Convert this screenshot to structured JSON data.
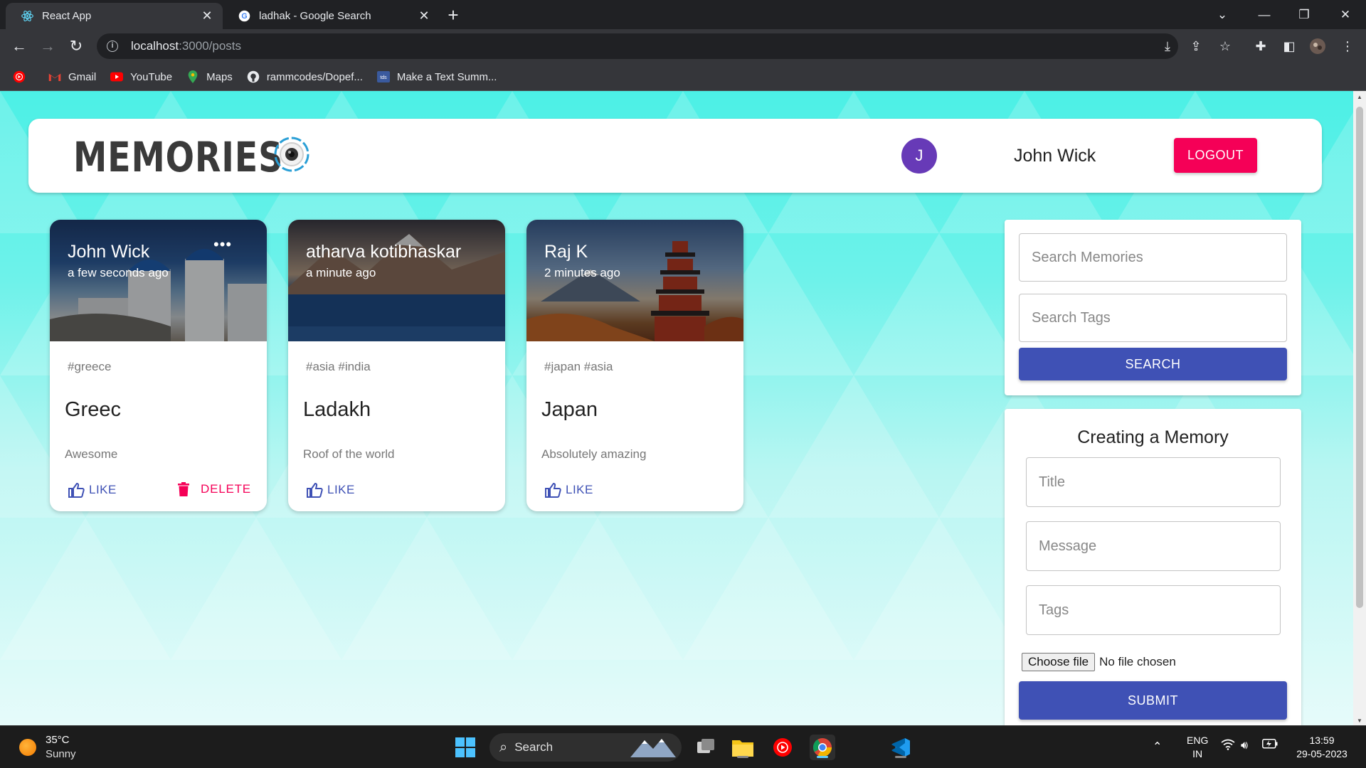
{
  "browser": {
    "tabs": [
      {
        "title": "React App",
        "active": true
      },
      {
        "title": "ladhak - Google Search",
        "active": false
      }
    ],
    "url_host": "localhost",
    "url_path": ":3000/posts",
    "bookmarks": [
      "Gmail",
      "YouTube",
      "Maps",
      "rammcodes/Dopef...",
      "Make a Text Summ..."
    ]
  },
  "header": {
    "brand": "MEMORIES",
    "avatar_initial": "J",
    "user_name": "John Wick",
    "logout_label": "LOGOUT"
  },
  "posts": [
    {
      "author": "John Wick",
      "time": "a few seconds ago",
      "tags": "#greece",
      "title": "Greec",
      "message": "Awesome",
      "like_label": "LIKE",
      "delete_label": "DELETE"
    },
    {
      "author": "atharva kotibhaskar",
      "time": "a minute ago",
      "tags": "#asia #india",
      "title": "Ladakh",
      "message": "Roof of the world",
      "like_label": "LIKE"
    },
    {
      "author": "Raj K",
      "time": "2 minutes ago",
      "tags": "#japan #asia",
      "title": "Japan",
      "message": "Absolutely amazing",
      "like_label": "LIKE"
    }
  ],
  "search": {
    "memories_placeholder": "Search Memories",
    "tags_placeholder": "Search Tags",
    "button_label": "SEARCH"
  },
  "form": {
    "heading": "Creating a Memory",
    "title_placeholder": "Title",
    "message_placeholder": "Message",
    "tags_placeholder": "Tags",
    "file_button": "Choose file",
    "file_status": "No file chosen",
    "submit_label": "SUBMIT"
  },
  "taskbar": {
    "temperature": "35°C",
    "weather": "Sunny",
    "search_label": "Search",
    "lang_1": "ENG",
    "lang_2": "IN",
    "time": "13:59",
    "date": "29-05-2023"
  },
  "colors": {
    "primary": "#3f51b5",
    "secondary": "#f50057",
    "avatar": "#673ab7"
  }
}
